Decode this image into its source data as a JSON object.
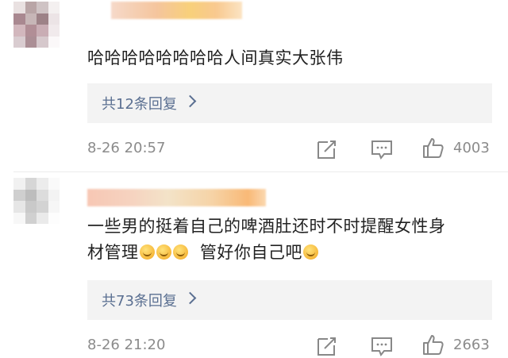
{
  "comments": [
    {
      "text": "哈哈哈哈哈哈哈哈人间真实大张伟",
      "replies_label": "共12条回复",
      "time": "8-26 20:57",
      "likes": "4003"
    },
    {
      "text_line1": "一些男的挺着自己的啤酒肚还时不时提醒女性身",
      "text_line2_a": "材管理",
      "text_line2_b": "管好你自己吧",
      "replies_label": "共73条回复",
      "time": "8-26 21:20",
      "likes": "2663"
    }
  ],
  "icons": {
    "share": "share-icon",
    "comment": "comment-icon",
    "like": "thumbs-up-icon",
    "reply_arrow": "chevron-right-icon",
    "emoji": "sweat-smile-emoji"
  },
  "colors": {
    "link": "#5a6f91",
    "meta": "#8b8b8b",
    "reply_bg": "#f3f3f3"
  }
}
